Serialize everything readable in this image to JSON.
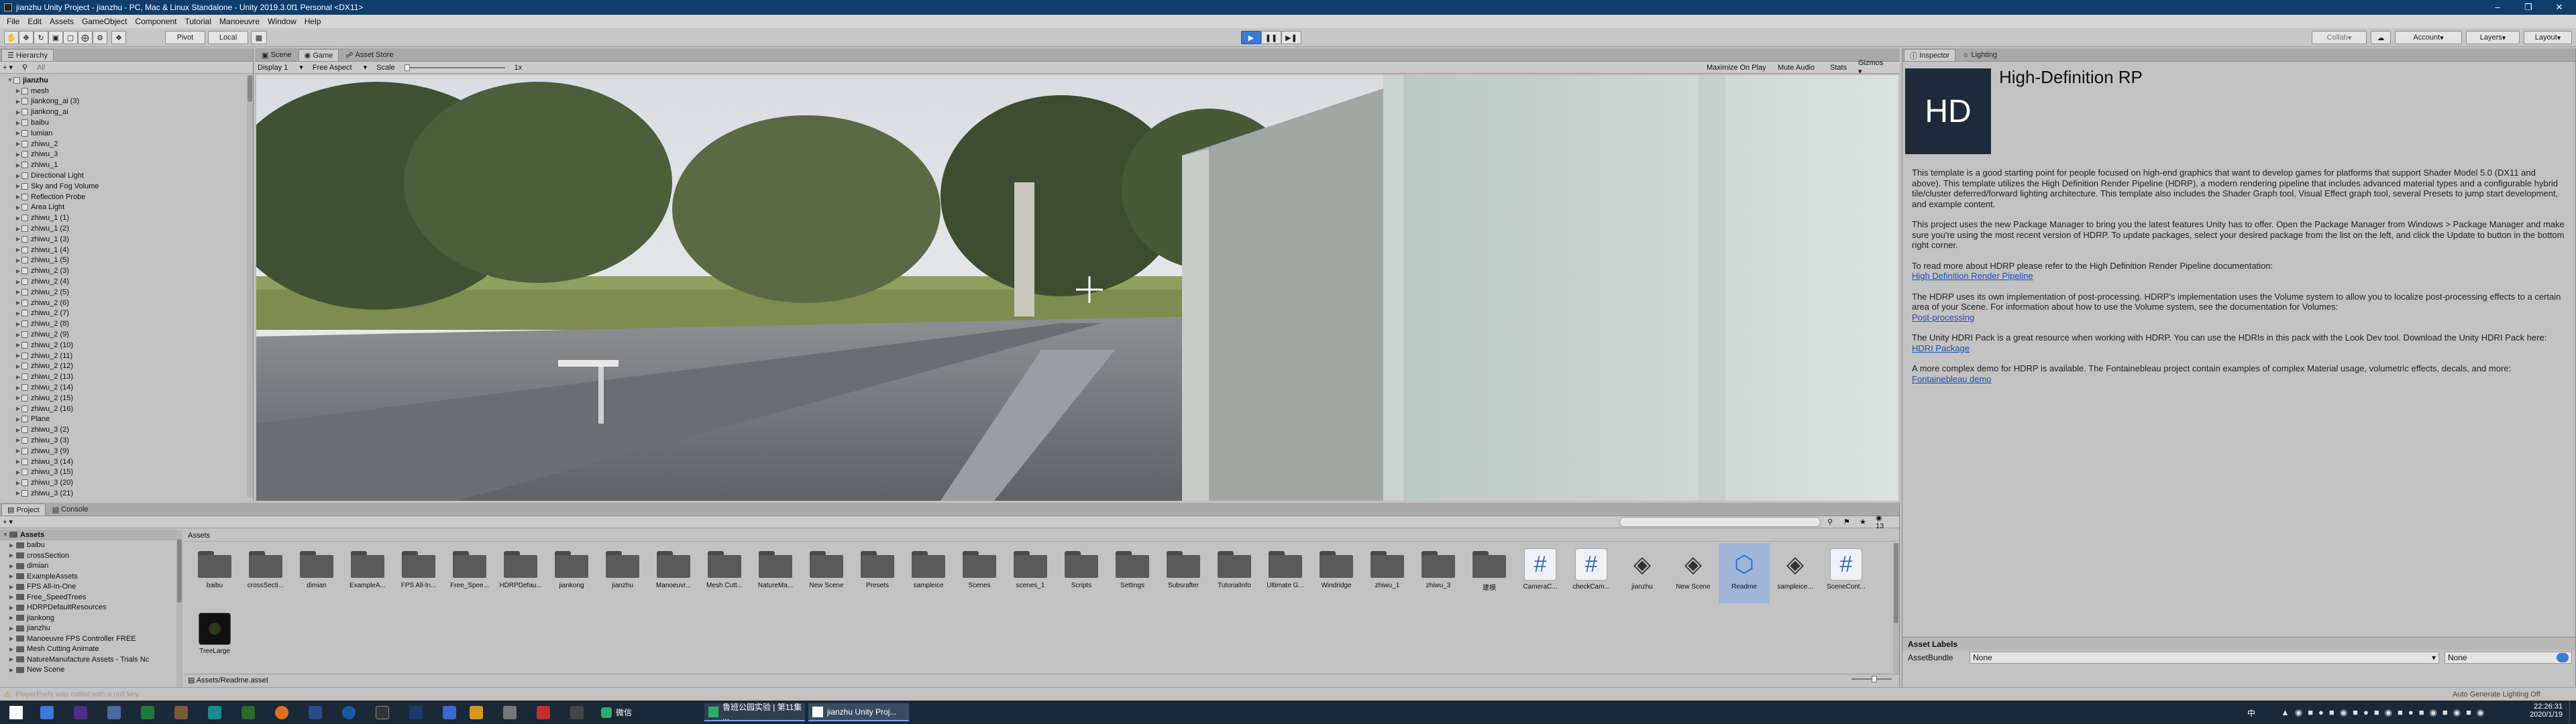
{
  "window": {
    "title": "jianzhu Unity Project - jianzhu - PC, Mac & Linux Standalone - Unity 2019.3.0f1 Personal <DX11>"
  },
  "menu": [
    "File",
    "Edit",
    "Assets",
    "GameObject",
    "Component",
    "Tutorial",
    "Manoeuvre",
    "Window",
    "Help"
  ],
  "toolbar": {
    "pivot": "Pivot",
    "local": "Local",
    "collab": "Collab",
    "account": "Account",
    "layers": "Layers",
    "layout": "Layout"
  },
  "hierarchy": {
    "tab": "Hierarchy",
    "search_placeholder": "All",
    "scene": "jianzhu",
    "items": [
      "mesh",
      "jiankong_ai (3)",
      "jiankong_ai",
      "baibu",
      "lumian",
      "zhiwu_2",
      "zhiwu_3",
      "zhiwu_1",
      "Directional Light",
      "Sky and Fog Volume",
      "Reflection Probe",
      "Area Light",
      "zhiwu_1 (1)",
      "zhiwu_1 (2)",
      "zhiwu_1 (3)",
      "zhiwu_1 (4)",
      "zhiwu_1 (5)",
      "zhiwu_2 (3)",
      "zhiwu_2 (4)",
      "zhiwu_2 (5)",
      "zhiwu_2 (6)",
      "zhiwu_2 (7)",
      "zhiwu_2 (8)",
      "zhiwu_2 (9)",
      "zhiwu_2 (10)",
      "zhiwu_2 (11)",
      "zhiwu_2 (12)",
      "zhiwu_2 (13)",
      "zhiwu_2 (14)",
      "zhiwu_2 (15)",
      "zhiwu_2 (16)",
      "Plane",
      "zhiwu_3 (2)",
      "zhiwu_3 (3)",
      "zhiwu_3 (9)",
      "zhiwu_3 (14)",
      "zhiwu_3 (15)",
      "zhiwu_3 (20)",
      "zhiwu_3 (21)"
    ]
  },
  "game_view": {
    "tabs": [
      "Scene",
      "Game",
      "Asset Store"
    ],
    "display": "Display 1",
    "aspect": "Free Aspect",
    "scale_label": "Scale",
    "scale_value": "1x",
    "maximize": "Maximize On Play",
    "mute": "Mute Audio",
    "stats": "Stats",
    "gizmos": "Gizmos"
  },
  "project": {
    "tabs": [
      "Project",
      "Console"
    ],
    "tree_root": "Assets",
    "tree": [
      "baibu",
      "crossSection",
      "dimian",
      "ExampleAssets",
      "FPS All-In-One",
      "Free_SpeedTrees",
      "HDRPDefaultResources",
      "jiankong",
      "jianzhu",
      "Manoeuvre FPS Controller FREE",
      "Mesh Cutting Animate",
      "NatureManufacture Assets - Trials Nc",
      "New Scene"
    ],
    "breadcrumb": "Assets",
    "folders": [
      "baibu",
      "crossSecti...",
      "dimian",
      "ExampleA...",
      "FPS All-In...",
      "Free_Spee...",
      "HDRPDefau...",
      "jiankong",
      "jianzhu",
      "Manoeuvr...",
      "Mesh Cutt...",
      "NatureMa...",
      "New Scene",
      "Presets",
      "sampleice",
      "Scenes",
      "scenes_1",
      "Scripts",
      "Settings",
      "Subsrafter",
      "TutorialInfo",
      "Ultimate G...",
      "Windridge",
      "zhiwu_1",
      "zhiwu_3",
      "建模"
    ],
    "files": [
      "CameraC...",
      "checkCam...",
      "jianzhu",
      "New Scene",
      "Readme",
      "sampleice...",
      "SceneCont..."
    ],
    "row2": [
      "TreeLarge"
    ],
    "path": "Assets/Readme.asset",
    "count": "13"
  },
  "inspector": {
    "tabs": [
      "Inspector",
      "Lighting"
    ],
    "icon_text": "HD",
    "title": "High-Definition RP",
    "p1": "This template is a good starting point for people focused on high-end graphics that want to develop games for platforms that support Shader Model 5.0 (DX11 and above). This template utilizes the High Definition Render Pipeline (HDRP), a modern rendering pipeline that includes advanced material types and a configurable hybrid tile/cluster deferred/forward lighting architecture. This template also includes the Shader Graph tool, Visual Effect graph tool, several Presets to jump start development, and example content.",
    "p2": "This project uses the new Package Manager to bring you the latest features Unity has to offer. Open the Package Manager from Windows > Package Manager and make sure you're using the most recent version of HDRP. To update packages, select your desired package from the list on the left, and click the Update to button in the bottom right corner.",
    "p3": "To read more about HDRP please refer to the High Definition Render Pipeline documentation:",
    "l3": "High Definition Render Pipeline",
    "p4": "The HDRP uses its own implementation of post-processing. HDRP's implementation uses the Volume system to allow you to localize post-processing effects to a certain area of your Scene. For information about how to use the Volume system, see the documentation for Volumes:",
    "l4": "Post-processing",
    "p5": "The Unity HDRI Pack is a great resource when working with HDRP. You can use the HDRIs in this pack with the Look Dev tool. Download the Unity HDRI Pack here:",
    "l5": "HDRI Package",
    "p6": "A more complex demo for HDRP is available. The Fontainebleau project contain examples of complex Material usage, volumetric effects, decals, and more:",
    "l6": "Fontainebleau demo",
    "asset_labels": "Asset Labels",
    "asset_bundle": "AssetBundle",
    "bundle_value": "None",
    "variant_value": "None"
  },
  "status": {
    "left": "PlayerPrefs was called with a null key...",
    "right": "Auto Generate Lighting Off"
  },
  "taskbar": {
    "apps": [
      "鲁班公园实验 | 第11集 ...",
      "jianzhu Unity Proj..."
    ],
    "wechat": "微信",
    "ime": "中",
    "time": "22:26:31",
    "date": "2020/1/19"
  },
  "colors": {
    "title_bg": "#0f3d6e",
    "taskbar_bg": "#1b2838",
    "play_blue": "#3a7bd5",
    "link": "#1a4fb5"
  }
}
